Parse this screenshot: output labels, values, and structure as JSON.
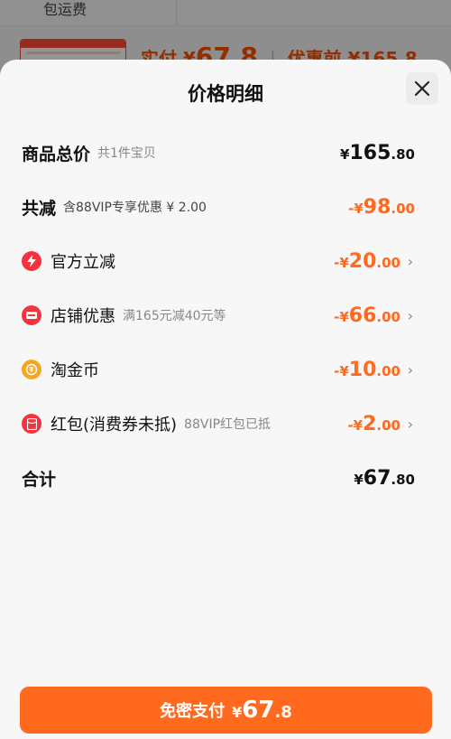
{
  "background": {
    "shipping_label": "包运费",
    "pay_label": "实付",
    "pay_currency": "¥",
    "pay_amount": "67.8",
    "before_label": "优惠前",
    "before_amount": "¥165.8"
  },
  "sheet": {
    "title": "价格明细"
  },
  "rows": {
    "total": {
      "label": "商品总价",
      "note": "共1件宝贝",
      "cur": "¥",
      "int": "165",
      "dec": ".80"
    },
    "reduce": {
      "label": "共减",
      "note": "含88VIP专享优惠 ¥ 2.00",
      "cur": "-¥",
      "int": "98",
      "dec": ".00"
    },
    "official": {
      "label": "官方立减",
      "cur": "-¥",
      "int": "20",
      "dec": ".00",
      "icon": "lightning-icon"
    },
    "shop": {
      "label": "店铺优惠",
      "note": "满165元减40元等",
      "cur": "-¥",
      "int": "66",
      "dec": ".00",
      "icon": "shop-coupon-icon"
    },
    "coin": {
      "label": "淘金币",
      "cur": "-¥",
      "int": "10",
      "dec": ".00",
      "icon": "coin-icon"
    },
    "redpacket": {
      "label": "红包(消费券未抵)",
      "note": "88VIP红包已抵",
      "cur": "-¥",
      "int": "2",
      "dec": ".00",
      "icon": "red-packet-icon"
    },
    "sum": {
      "label": "合计",
      "cur": "¥",
      "int": "67",
      "dec": ".80"
    }
  },
  "pay_button": {
    "label": "免密支付",
    "cur": "¥",
    "int": "67",
    "dec": ".8"
  },
  "colors": {
    "accent": "#ff6a1f",
    "red_icon": "#f5333f",
    "coin": "#f5a623"
  }
}
